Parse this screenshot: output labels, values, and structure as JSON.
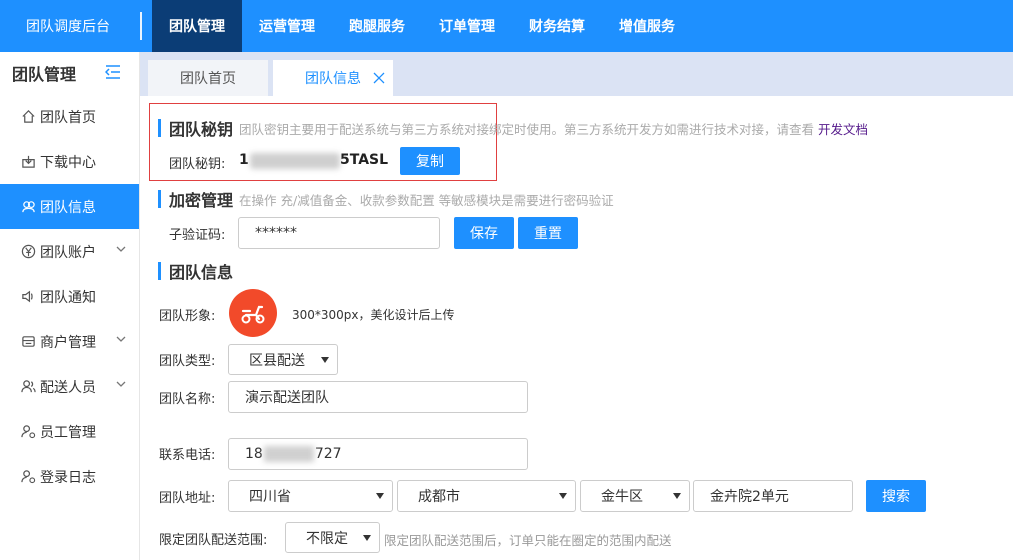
{
  "header": {
    "brand": "团队调度后台",
    "nav": [
      {
        "label": "团队管理",
        "active": true
      },
      {
        "label": "运营管理",
        "active": false
      },
      {
        "label": "跑腿服务",
        "active": false
      },
      {
        "label": "订单管理",
        "active": false
      },
      {
        "label": "财务结算",
        "active": false
      },
      {
        "label": "增值服务",
        "active": false
      }
    ],
    "accent": "#1e90ff"
  },
  "sidebar": {
    "title": "团队管理",
    "items": [
      {
        "label": "团队首页",
        "icon": "home-icon"
      },
      {
        "label": "下载中心",
        "icon": "download-icon"
      },
      {
        "label": "团队信息",
        "icon": "team-info-icon",
        "active": true
      },
      {
        "label": "团队账户",
        "icon": "yen-icon",
        "expandable": true
      },
      {
        "label": "团队通知",
        "icon": "speaker-icon"
      },
      {
        "label": "商户管理",
        "icon": "merchant-icon",
        "expandable": true
      },
      {
        "label": "配送人员",
        "icon": "users-icon",
        "expandable": true
      },
      {
        "label": "员工管理",
        "icon": "staff-icon"
      },
      {
        "label": "登录日志",
        "icon": "log-icon"
      }
    ]
  },
  "tabs": [
    {
      "label": "团队首页"
    },
    {
      "label": "团队信息",
      "active": true
    }
  ],
  "secret": {
    "title": "团队秘钥",
    "desc": "团队密钥主要用于配送系统与第三方系统对接绑定时使用。第三方系统开发方如需进行技术对接，请查看",
    "link": "开发文档",
    "label": "团队秘钥:",
    "value_prefix": "1",
    "value_suffix": "5TASL",
    "copy_label": "复制"
  },
  "encrypt": {
    "title": "加密管理",
    "desc": "在操作 充/减值备金、收款参数配置 等敏感模块是需要进行密码验证",
    "label": "子验证码:",
    "value": "******",
    "save_label": "保存",
    "reset_label": "重置"
  },
  "info": {
    "title": "团队信息",
    "image_label": "团队形象:",
    "image_hint": "300*300px，美化设计后上传",
    "type_label": "团队类型:",
    "type_value": "区县配送",
    "name_label": "团队名称:",
    "name_value": "演示配送团队",
    "phone_label": "联系电话:",
    "phone_prefix": "18",
    "phone_suffix": "727",
    "address_label": "团队地址:",
    "province": "四川省",
    "city": "成都市",
    "district": "金牛区",
    "street": "金卉院2单元",
    "search_label": "搜索",
    "range_label": "限定团队配送范围:",
    "range_value": "不限定",
    "range_hint": "限定团队配送范围后，订单只能在圈定的范围内配送"
  }
}
